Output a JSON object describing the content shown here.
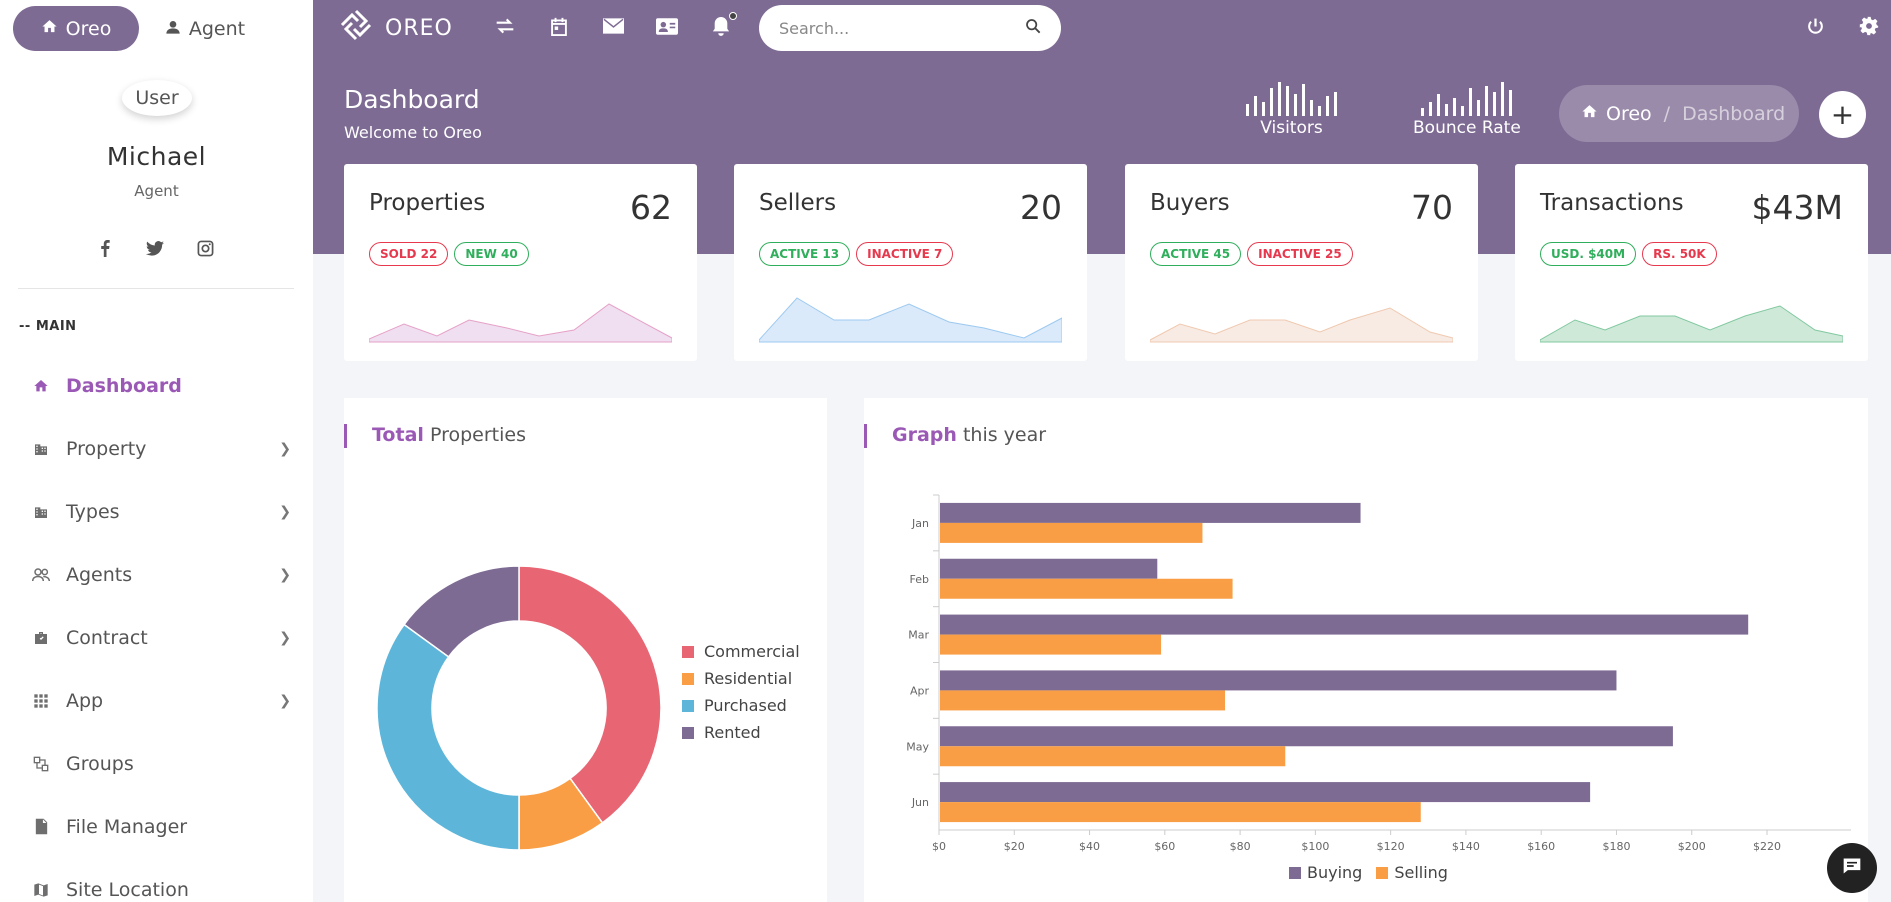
{
  "sidebar": {
    "tabs": [
      {
        "label": "Oreo"
      },
      {
        "label": "Agent"
      }
    ],
    "user": {
      "img_alt": "User",
      "name": "Michael",
      "role": "Agent"
    },
    "section_title": "-- MAIN",
    "items": [
      {
        "label": "Dashboard",
        "icon": "home-icon"
      },
      {
        "label": "Property",
        "icon": "building-icon"
      },
      {
        "label": "Types",
        "icon": "building-icon"
      },
      {
        "label": "Agents",
        "icon": "people-icon"
      },
      {
        "label": "Contract",
        "icon": "briefcase-icon"
      },
      {
        "label": "App",
        "icon": "apps-grid-icon"
      },
      {
        "label": "Groups",
        "icon": "groups-icon"
      },
      {
        "label": "File Manager",
        "icon": "file-icon"
      },
      {
        "label": "Site Location",
        "icon": "map-icon"
      }
    ]
  },
  "header": {
    "brand": "OREO",
    "search_placeholder": "Search...",
    "page_title": "Dashboard",
    "subtitle": "Welcome to Oreo",
    "visitors_label": "Visitors",
    "bounce_label": "Bounce Rate",
    "breadcrumb": {
      "home": "Oreo",
      "current": "Dashboard"
    },
    "plus": "+"
  },
  "stats": [
    {
      "title": "Properties",
      "value": "62",
      "badges": [
        {
          "text": "SOLD 22",
          "tone": "red"
        },
        {
          "text": "NEW 40",
          "tone": "green"
        }
      ],
      "color": "#e6a1c8"
    },
    {
      "title": "Sellers",
      "value": "20",
      "badges": [
        {
          "text": "ACTIVE 13",
          "tone": "green"
        },
        {
          "text": "INACTIVE 7",
          "tone": "red"
        }
      ],
      "color": "#9cc9f0"
    },
    {
      "title": "Buyers",
      "value": "70",
      "badges": [
        {
          "text": "ACTIVE 45",
          "tone": "green"
        },
        {
          "text": "INACTIVE 25",
          "tone": "red"
        }
      ],
      "color": "#f0c9b0"
    },
    {
      "title": "Transactions",
      "value": "$43M",
      "badges": [
        {
          "text": "USD. $40M",
          "tone": "green"
        },
        {
          "text": "RS. 50K",
          "tone": "red"
        }
      ],
      "color": "#82c9a0"
    }
  ],
  "panels": {
    "total_title_bold": "Total",
    "total_title_rest": "Properties",
    "graph_title_bold": "Graph",
    "graph_title_rest": "this year"
  },
  "chart_data": [
    {
      "type": "pie",
      "donut": true,
      "categories": [
        "Commercial",
        "Residential",
        "Purchased",
        "Rented"
      ],
      "values": [
        40,
        10,
        35,
        15
      ],
      "colors": [
        "#e86674",
        "#f99e45",
        "#5db6da",
        "#7e6b94"
      ],
      "legend": "right"
    },
    {
      "type": "bar",
      "orientation": "horizontal",
      "categories": [
        "Jan",
        "Feb",
        "Mar",
        "Apr",
        "May",
        "Jun"
      ],
      "series": [
        {
          "name": "Buying",
          "values": [
            112,
            58,
            215,
            180,
            195,
            173
          ],
          "color": "#7e6b94"
        },
        {
          "name": "Selling",
          "values": [
            70,
            78,
            59,
            76,
            92,
            128
          ],
          "color": "#f99e45"
        }
      ],
      "xticks": [
        "$0",
        "$20",
        "$40",
        "$60",
        "$80",
        "$100",
        "$120",
        "$140",
        "$160",
        "$180",
        "$200",
        "$220"
      ],
      "xlim": [
        0,
        237
      ],
      "legend": "bottom"
    }
  ]
}
